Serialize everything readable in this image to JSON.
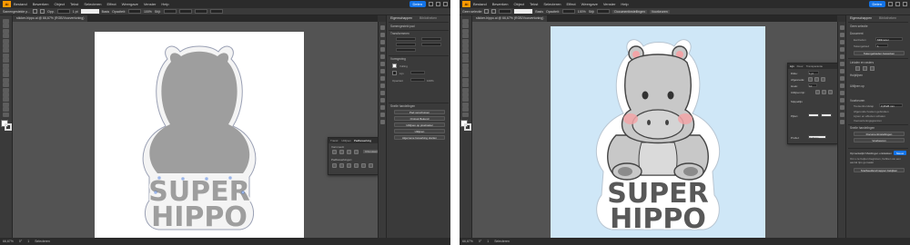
{
  "colors": {
    "accent": "#1473e6",
    "app_logo": "#ff9a00",
    "canvas_bg": "#535353",
    "artboard_left": "#ffffff",
    "artboard_right": "#cfe7f7",
    "silhouette": "#9e9e9e",
    "hippo_body": "#c8c8c8",
    "cheek": "#f2a4a7",
    "text_dark": "#585858"
  },
  "menu": [
    "Bestand",
    "Bewerken",
    "Object",
    "Tekst",
    "Selecteren",
    "Effect",
    "Weergave",
    "Venster",
    "Help"
  ],
  "app_logo": "Ai",
  "share_label": "Delen",
  "left": {
    "control_bar": [
      "Samengestelde p...",
      "Opp.",
      "1 pt",
      "Basis",
      "Opaciteit:",
      "100%",
      "Stijl:"
    ],
    "tab_label": "sticker-hippo.ai @ 66,67% (RGB/Voorvertoning)",
    "status": [
      "66,67%",
      "0°",
      "1",
      "Selecteren"
    ],
    "props": {
      "tab_active": "Eigenschappen",
      "tab_inactive": "Bibliotheken",
      "sec1": "Samengesteld pad",
      "sec2": "Transformeren",
      "sec3": "Vormgeving",
      "fill_label": "Vulling",
      "stroke_label": "Lijn",
      "opacity_label": "Opaciteit",
      "opacity_value": "100%",
      "sec4": "Snelle handelingen",
      "btn1": "Pad verschuiven",
      "btn2": "Omtrek Bekend",
      "btn3": "Uitlijnen op pixelraster",
      "btn4": "Uitlijnen",
      "btn5": "Algemene bewerking starten"
    },
    "float": {
      "tabs": [
        "Transf.",
        "Uitlijnen",
        "Padbewerking"
      ],
      "sub1": "Vormmodi:",
      "sub2": "Padbewerkingen:",
      "expand": "Uitvouwen"
    },
    "art": {
      "line1": "SUPER",
      "line2": "HIPPO"
    }
  },
  "right": {
    "control_bar": [
      "Geen selectie",
      "Basis",
      "Opaciteit:",
      "100%",
      "Stijl:",
      "Documentinstellingen",
      "Voorkeuren"
    ],
    "tab_label": "sticker-hippo.ai @ 66,67% (RGB/Voorvertoning)",
    "status": [
      "66,67%",
      "0°",
      "1",
      "Selecteren"
    ],
    "props": {
      "tab_active": "Eigenschappen",
      "tab_inactive": "Bibliotheken",
      "sec1": "Geen selectie",
      "sec2": "Document",
      "units_label": "Eenheden",
      "units_value": "Millimeter",
      "artboard_label": "Tekengebied",
      "artboard_value": "1",
      "edit_artboards": "Tekengebieden bewerken",
      "sec3": "Linialen en rasters",
      "sec4": "Hulplijnen",
      "sec5": "Uitlijnen op",
      "sec6": "Voorkeuren",
      "keyb_label": "Toetsenbordstap",
      "keyb_value": "0,3528 mm",
      "cb1": "Afgeronde hoeken gebruiken",
      "cb2": "Lijnen en effecten schalen",
      "cb3": "Voorvertoningsgrenzen",
      "sec7": "Snelle handelingen",
      "btn1": "Documentinstellingen",
      "btn2": "Voorkeuren",
      "msg": "Opmerkelijk! Meldingen ontdekken",
      "msg2": "Nieuw",
      "msg3": "Om u te helpen beginnen, hebben we een aantal tips gemaakt",
      "btn3": "Snelbeelden/mappen bekijken"
    },
    "float": {
      "tabs": [
        "Lijn",
        "Kleur",
        "Transparantie"
      ],
      "rows": [
        "Dikte:",
        "Afgesnede:",
        "Hoek:",
        "Uitlijnen lijn:",
        "Stippellijn",
        "Pijlen:",
        "Profiel:"
      ],
      "row_vals": [
        "1 pt",
        "",
        "10",
        "",
        "",
        "",
        "Uniform"
      ]
    },
    "art": {
      "line1": "SUPER",
      "line2": "HIPPO"
    }
  }
}
